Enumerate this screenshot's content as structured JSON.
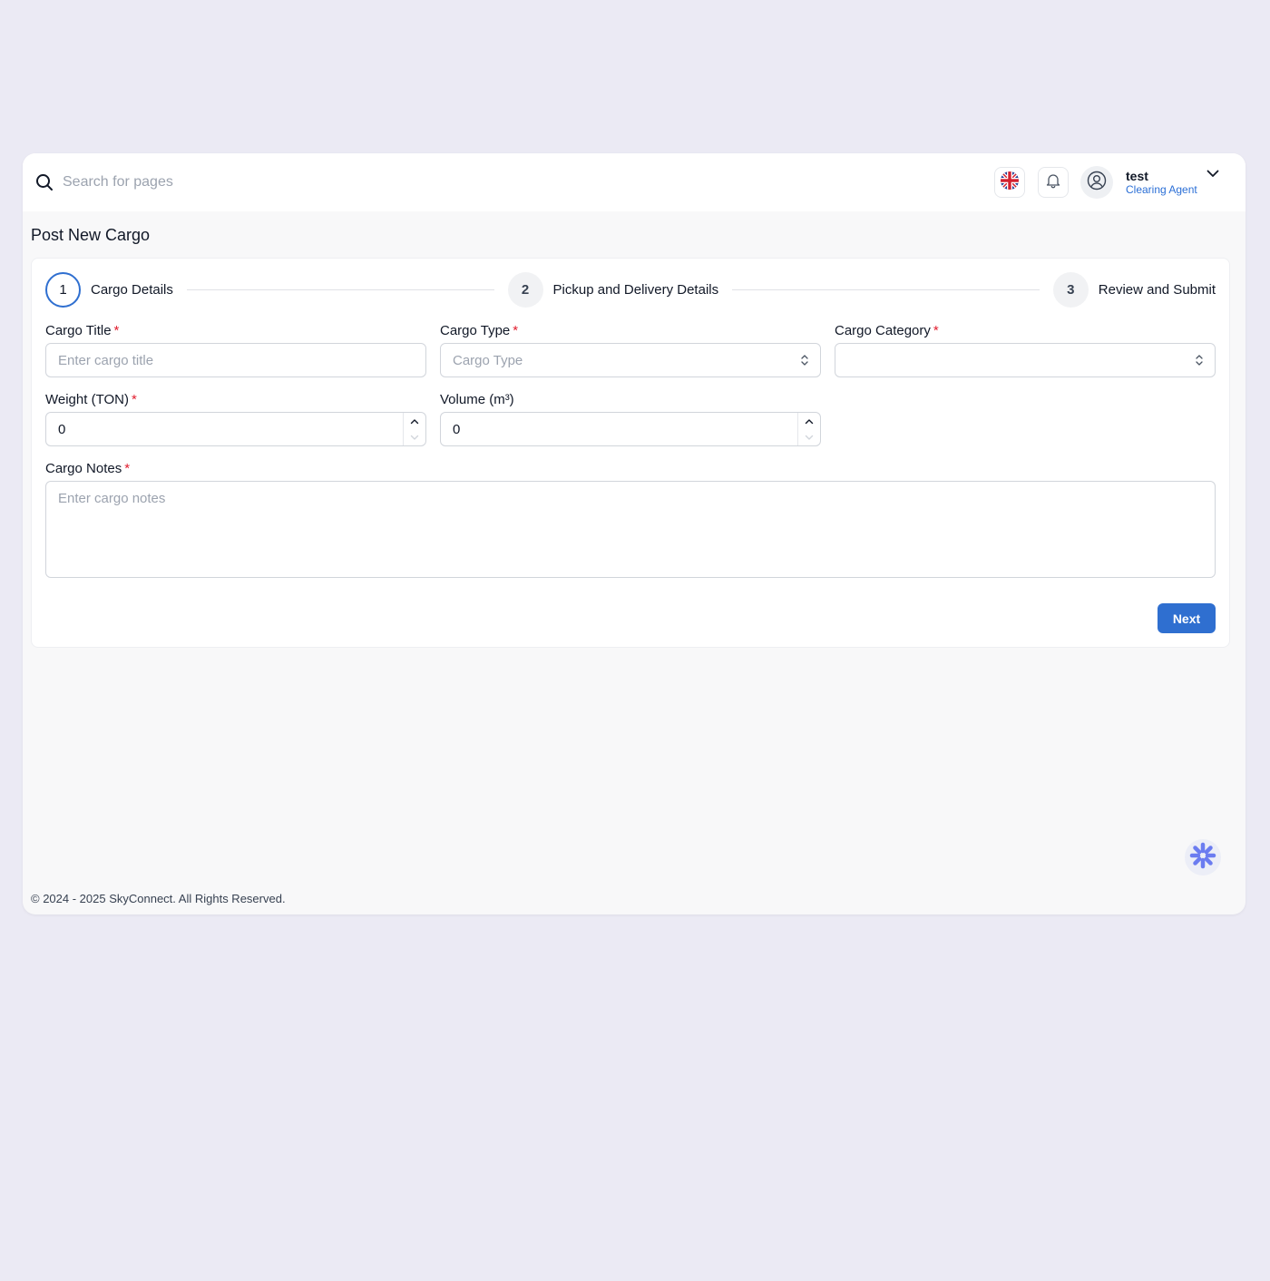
{
  "search": {
    "placeholder": "Search for pages"
  },
  "header": {
    "user_name": "test",
    "user_role": "Clearing Agent"
  },
  "page": {
    "title": "Post New Cargo"
  },
  "stepper": {
    "steps": [
      {
        "number": "1",
        "label": "Cargo Details",
        "active": true
      },
      {
        "number": "2",
        "label": "Pickup and Delivery Details",
        "active": false
      },
      {
        "number": "3",
        "label": "Review and Submit",
        "active": false
      }
    ]
  },
  "form": {
    "cargo_title": {
      "label": "Cargo Title",
      "required_mark": "*",
      "placeholder": "Enter cargo title",
      "value": ""
    },
    "cargo_type": {
      "label": "Cargo Type",
      "required_mark": "*",
      "selected": "Cargo Type"
    },
    "cargo_category": {
      "label": "Cargo Category",
      "required_mark": "*",
      "selected": ""
    },
    "weight": {
      "label": "Weight (TON)",
      "required_mark": "*",
      "value": "0"
    },
    "volume": {
      "label": "Volume (m³)",
      "value": "0"
    },
    "cargo_notes": {
      "label": "Cargo Notes",
      "required_mark": "*",
      "placeholder": "Enter cargo notes",
      "value": ""
    },
    "next_label": "Next"
  },
  "footer": {
    "text": "© 2024 - 2025 SkyConnect. All Rights Reserved."
  },
  "colors": {
    "accent": "#2f6fd0",
    "required": "#e11d2e",
    "page_background": "#ebeaf4",
    "role_text": "#2b6fd6"
  },
  "icons": {
    "search": "search-icon",
    "language": "uk-flag-icon",
    "notifications": "bell-icon",
    "avatar": "user-circle-icon",
    "menu": "chevron-down-icon",
    "widget": "asterisk-spinner-icon"
  }
}
